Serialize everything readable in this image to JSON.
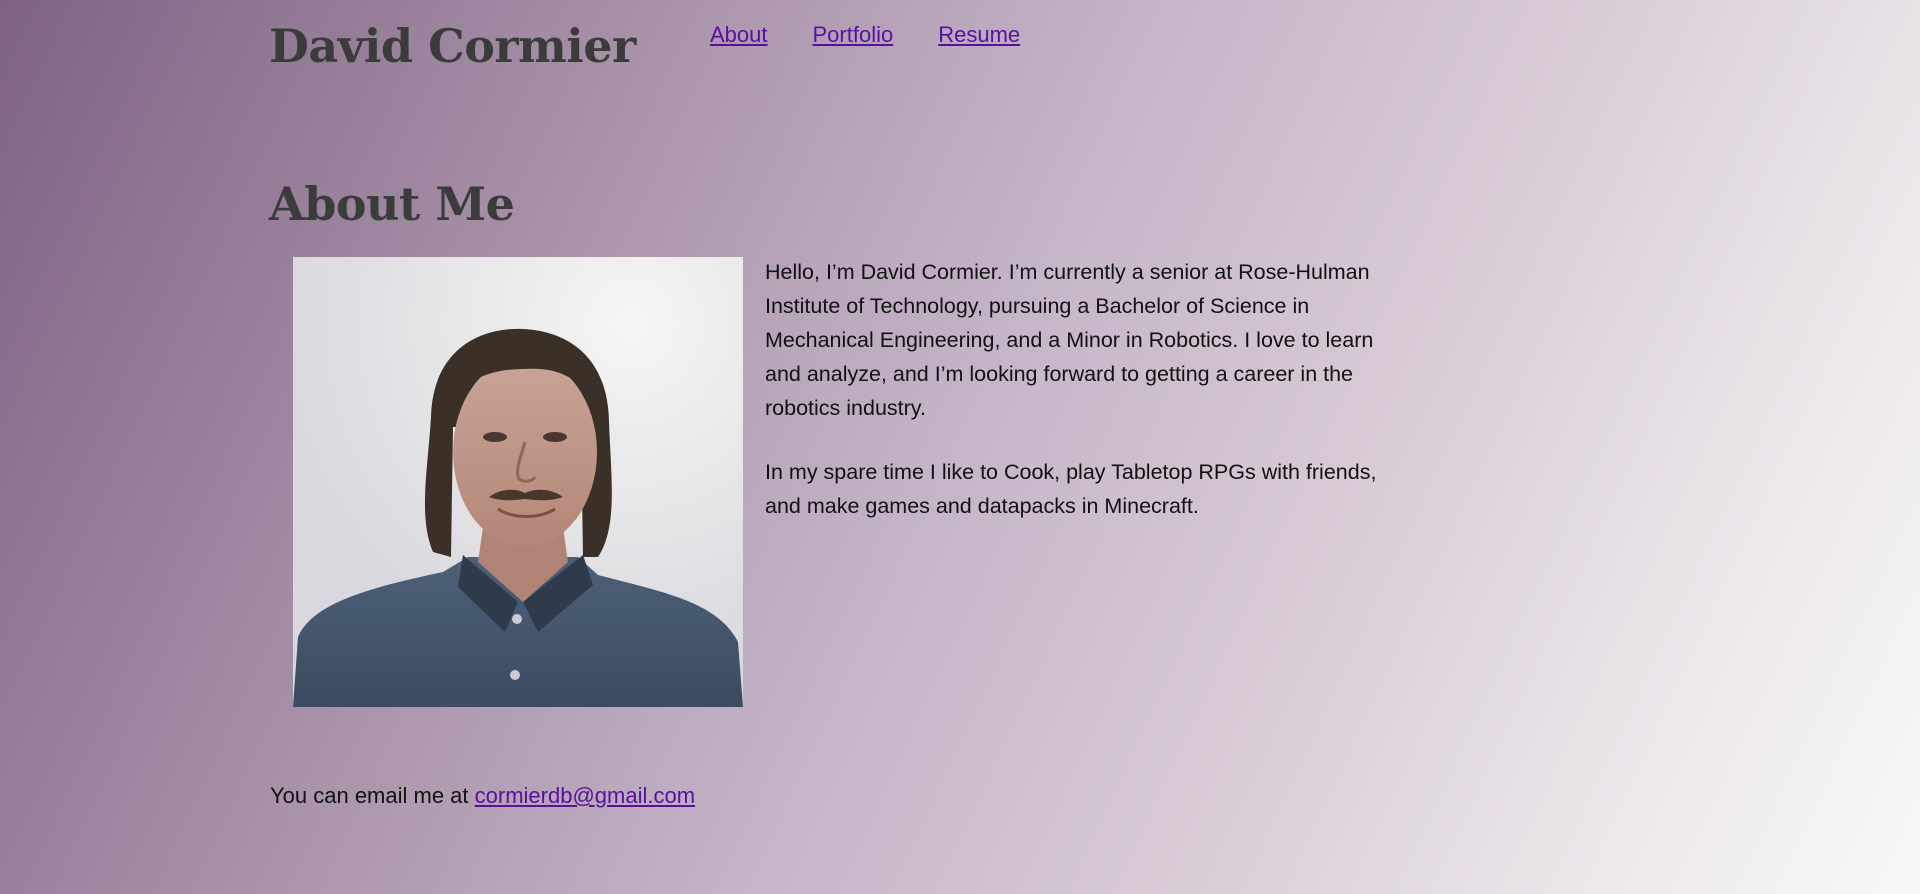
{
  "header": {
    "site_title": "David Cormier",
    "nav": {
      "about": "About",
      "portfolio": "Portfolio",
      "resume": "Resume"
    }
  },
  "main": {
    "heading": "About Me",
    "portrait_alt": "Portrait photo of David Cormier",
    "bio": {
      "paragraph1": "Hello, I’m David Cormier. I’m currently a senior at Rose-Hulman Institute of Technology, pursuing a Bachelor of Science in Mechanical Engineering, and a Minor in Robotics. I love to learn and analyze, and I’m looking forward to getting a career in the robotics industry.",
      "paragraph2": "In my spare time I like to Cook, play Tabletop RPGs with friends, and make games and datapacks in Minecraft."
    },
    "contact": {
      "prefix": "You can email me at ",
      "email": "cormierdb@gmail.com"
    }
  },
  "colors": {
    "link": "#5a0fa0",
    "heading": "#3b3b3b",
    "gradient_start": "#7e6384",
    "gradient_end": "#f8f8f8"
  }
}
